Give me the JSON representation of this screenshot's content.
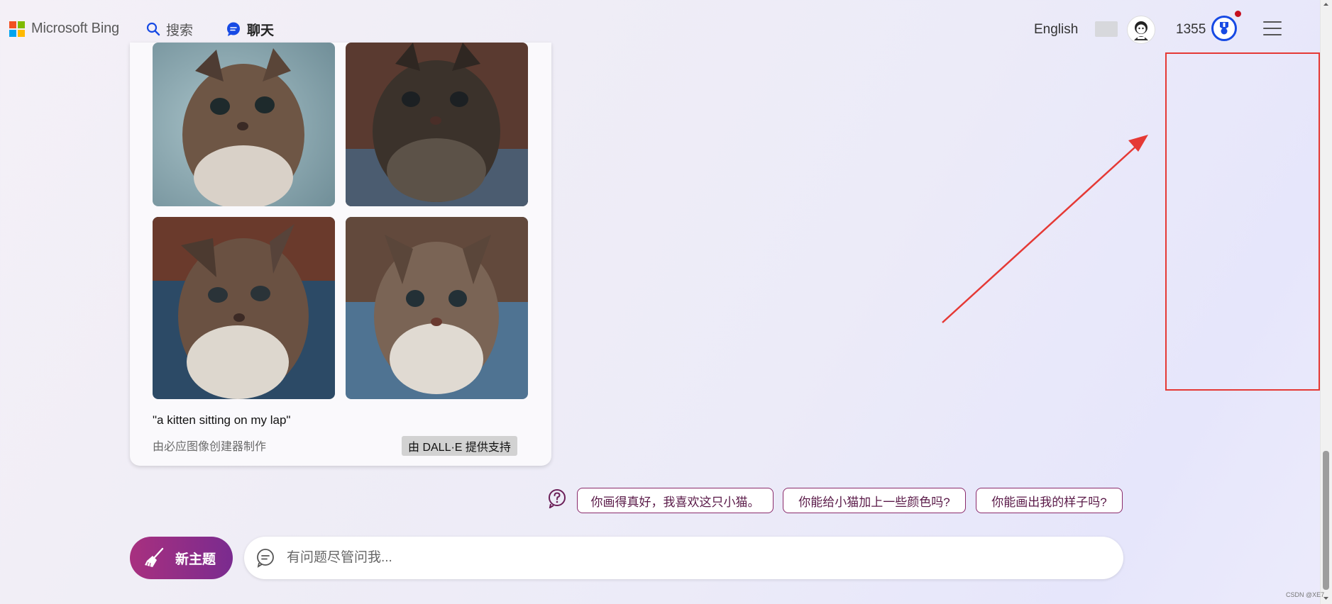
{
  "header": {
    "logo_text": "Microsoft Bing",
    "tabs": [
      {
        "label": "搜索",
        "active": false
      },
      {
        "label": "聊天",
        "active": true
      }
    ],
    "language": "English",
    "points": "1355"
  },
  "card": {
    "caption": "\"a kitten sitting on my lap\"",
    "credit": "由必应图像创建器制作",
    "dalle_badge": "由 DALL·E 提供支持"
  },
  "suggestions": [
    "你画得真好，我喜欢这只小猫。",
    "你能给小猫加上一些颜色吗?",
    "你能画出我的样子吗?"
  ],
  "composer": {
    "new_topic_label": "新主题",
    "placeholder": "有问题尽管问我..."
  },
  "watermark": "CSDN @XE7",
  "colors": {
    "accent": "#174ae4",
    "chip_border": "#8a2a6b",
    "new_topic_start": "#a8307f",
    "new_topic_end": "#7a2b8f",
    "annotation": "#e53935"
  }
}
